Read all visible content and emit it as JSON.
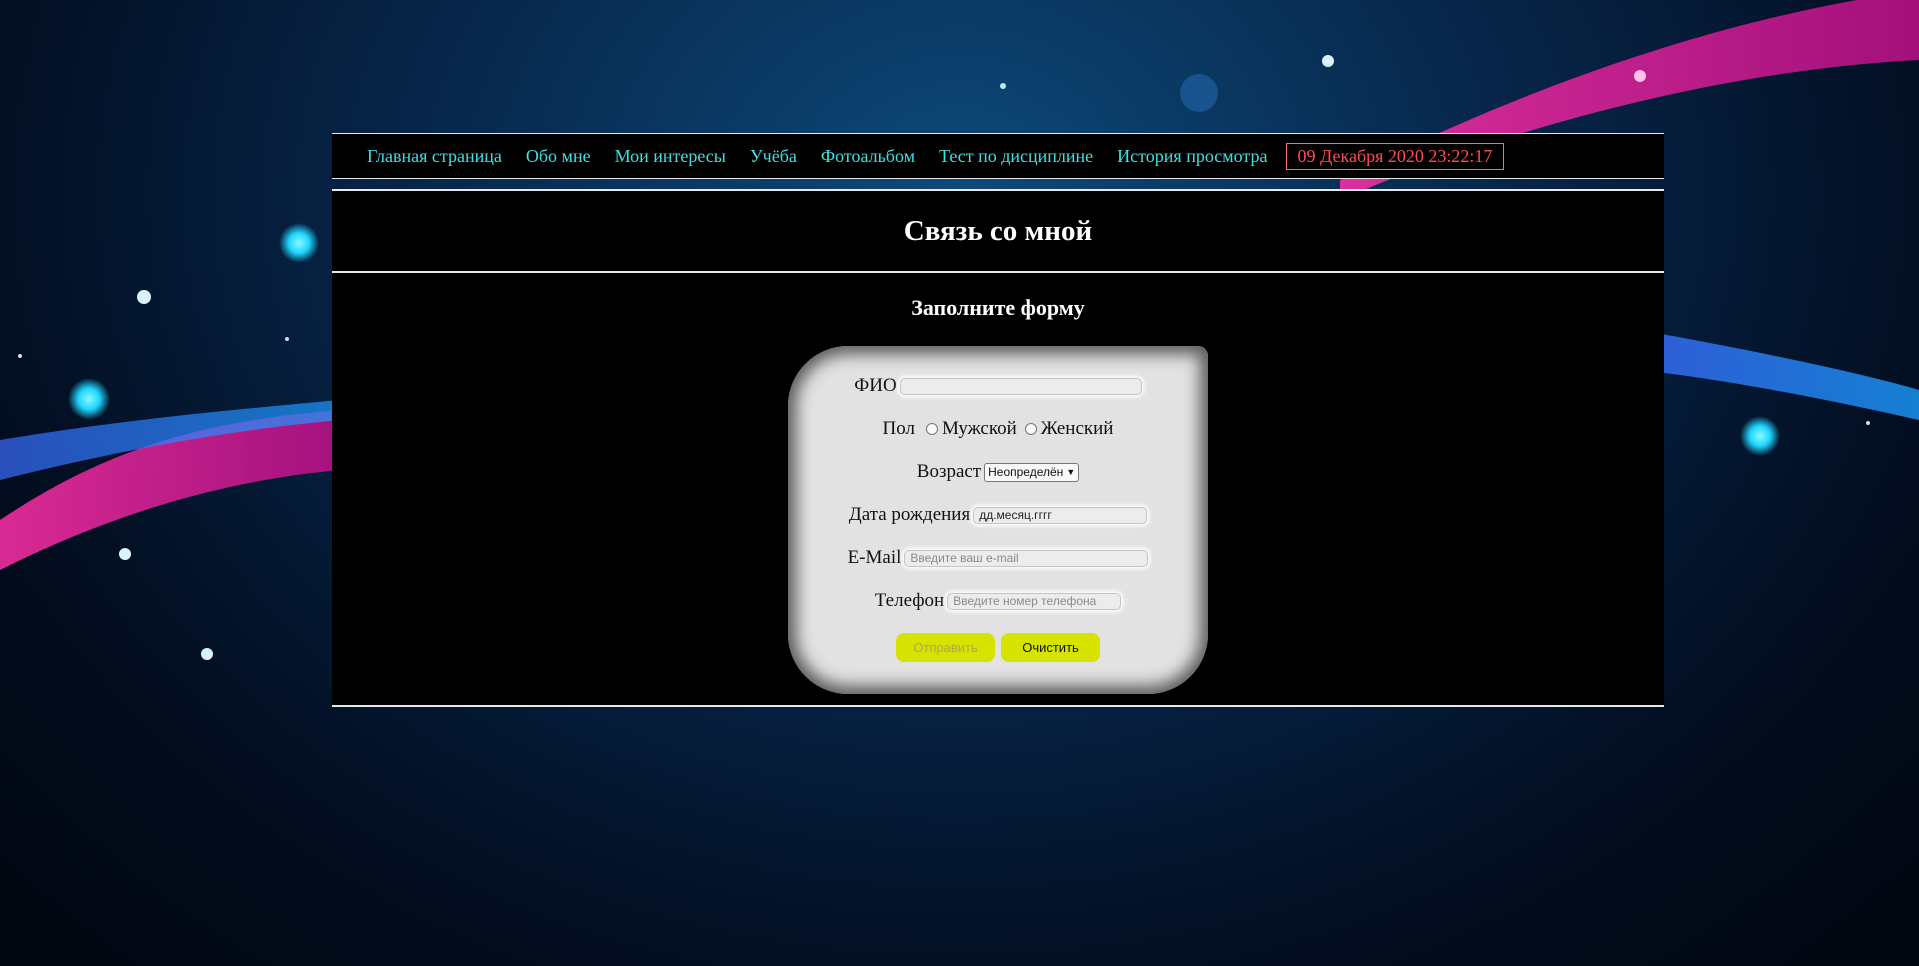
{
  "nav": {
    "links": [
      "Главная страница",
      "Обо мне",
      "Мои интересы",
      "Учёба",
      "Фотоальбом",
      "Тест по дисциплине",
      "История просмотра"
    ],
    "clock": "09 Декабря 2020 23:22:17"
  },
  "header": {
    "title": "Связь со мной"
  },
  "form": {
    "title": "Заполните форму",
    "fio_label": "ФИО",
    "fio_value": "",
    "gender_label": "Пол",
    "gender_male": "Мужской",
    "gender_female": "Женский",
    "age_label": "Возраст",
    "age_selected": "Неопределён",
    "birth_label": "Дата рождения",
    "birth_value": "дд.месяц.гггг",
    "email_label": "E-Mail",
    "email_placeholder": "Введите ваш e-mail",
    "phone_label": "Телефон",
    "phone_placeholder": "Введите номер телефона",
    "submit_label": "Отправить",
    "clear_label": "Очистить"
  },
  "colors": {
    "nav_link": "#3fe0e4",
    "clock": "#ff4a55",
    "button": "#d6e300",
    "card": "#e2e2e2"
  }
}
